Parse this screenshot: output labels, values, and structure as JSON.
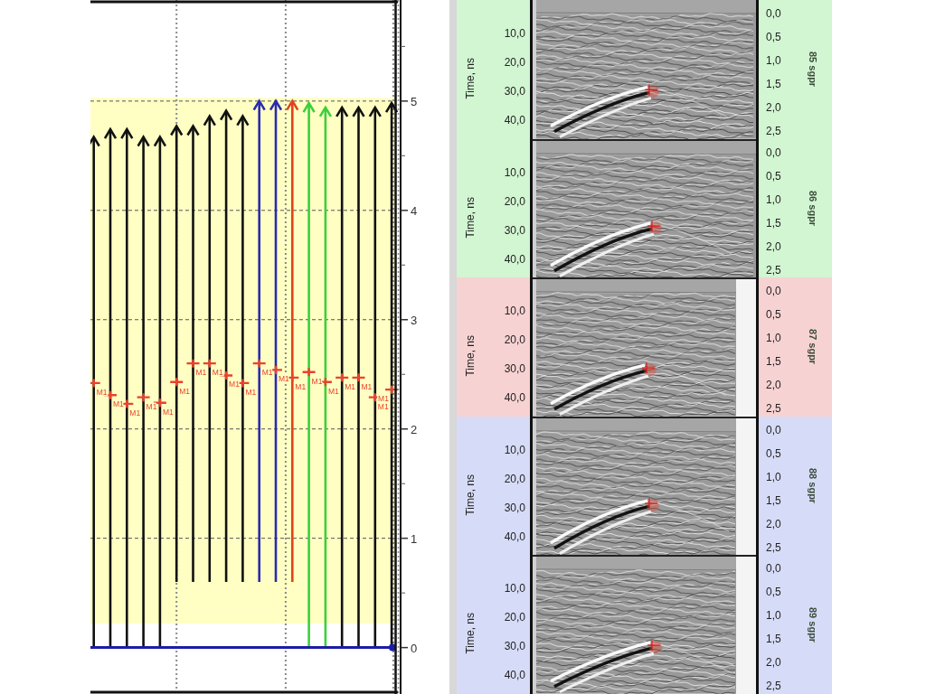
{
  "track_chart": {
    "arrows": [
      {
        "reaches_baseline": true
      },
      {
        "reaches_baseline": true
      },
      {
        "reaches_baseline": true
      },
      {
        "reaches_baseline": true
      },
      {
        "reaches_baseline": true
      },
      {
        "reaches_baseline": false
      },
      {
        "reaches_baseline": false
      },
      {
        "reaches_baseline": false
      },
      {
        "reaches_baseline": false
      },
      {
        "reaches_baseline": false
      },
      {
        "reaches_baseline": false
      },
      {
        "reaches_baseline": false
      },
      {
        "reaches_baseline": false
      },
      {
        "reaches_baseline": true
      },
      {
        "reaches_baseline": true
      },
      {
        "reaches_baseline": true
      },
      {
        "reaches_baseline": true
      },
      {
        "reaches_baseline": true
      },
      {
        "reaches_baseline": true
      }
    ],
    "chart_data": {
      "type": "scatter",
      "categories": [
        null,
        null,
        null,
        null,
        null,
        null,
        null,
        null,
        null,
        null,
        null,
        null,
        null,
        null,
        null,
        null,
        null,
        null,
        null
      ],
      "ylim": [
        -0.4,
        5.9
      ],
      "yticks": [
        {
          "value": 0,
          "label": "0"
        },
        {
          "value": 1,
          "label": "1"
        },
        {
          "value": 2,
          "label": "2"
        },
        {
          "value": 3,
          "label": "3"
        },
        {
          "value": 4,
          "label": "4"
        },
        {
          "value": 5,
          "label": "5"
        }
      ],
      "grid": true,
      "series": [
        {
          "color": "#e8432e",
          "values": [
            2.42,
            2.31,
            2.23,
            2.29,
            2.24,
            2.43,
            2.6,
            2.6,
            2.49,
            2.42,
            2.6,
            2.54,
            2.47,
            2.52,
            2.43,
            2.47,
            2.47,
            2.29,
            2.36
          ]
        },
        {
          "values": [
            4.63,
            4.7,
            4.7,
            4.63,
            4.63,
            4.73,
            4.73,
            4.82,
            4.87,
            4.82,
            4.96,
            4.96,
            4.96,
            4.94,
            4.9,
            4.9,
            4.9,
            4.9,
            4.94
          ],
          "colors": [
            "#111111",
            "#111111",
            "#111111",
            "#111111",
            "#111111",
            "#111111",
            "#111111",
            "#111111",
            "#111111",
            "#111111",
            "#2b2bb0",
            "#2b2bb0",
            "#e0441c",
            "#3ccf3c",
            "#3ccf3c",
            "#111111",
            "#111111",
            "#111111",
            "#111111"
          ]
        }
      ],
      "value_labels": [
        "M1",
        "M1",
        "M1",
        "M1",
        "M1",
        "M1",
        "M1",
        "M1",
        "M1",
        "M1",
        "M1",
        "M1",
        "M1",
        "M1",
        "M1",
        "M1",
        "M1",
        "M1",
        "M1"
      ],
      "bands": [
        {
          "axis": "y",
          "from": 0.22,
          "to": 5.03,
          "color": "#ffffc4"
        }
      ],
      "ref_lines": [
        {
          "axis": "y",
          "value": 0,
          "color": "#1c1ca8"
        }
      ]
    }
  },
  "radargrams": [
    {
      "color": "#d2f5d2",
      "trimmed": false,
      "time_title": "Time, ns",
      "time_ticks": [
        "10,0",
        "20,0",
        "30,0",
        "40,0"
      ],
      "depth_ticks": [
        "0,0",
        "0,5",
        "1,0",
        "1,5",
        "2,0",
        "2,5"
      ],
      "label": "85 sgpr"
    },
    {
      "color": "#d2f5d2",
      "trimmed": false,
      "time_title": "Time, ns",
      "time_ticks": [
        "10,0",
        "20,0",
        "30,0",
        "40,0"
      ],
      "depth_ticks": [
        "0,0",
        "0,5",
        "1,0",
        "1,5",
        "2,0",
        "2,5"
      ],
      "label": "86 sgpr"
    },
    {
      "color": "#f7d2d2",
      "trimmed": true,
      "time_title": "Time, ns",
      "time_ticks": [
        "10,0",
        "20,0",
        "30,0",
        "40,0"
      ],
      "depth_ticks": [
        "0,0",
        "0,5",
        "1,0",
        "1,5",
        "2,0",
        "2,5"
      ],
      "label": "87 sgpr"
    },
    {
      "color": "#d6dcf7",
      "trimmed": true,
      "time_title": "Time, ns",
      "time_ticks": [
        "10,0",
        "20,0",
        "30,0",
        "40,0"
      ],
      "depth_ticks": [
        "0,0",
        "0,5",
        "1,0",
        "1,5",
        "2,0",
        "2,5"
      ],
      "label": "88 sgpr"
    },
    {
      "color": "#d6dcf7",
      "trimmed": true,
      "time_title": "Time, ns",
      "time_ticks": [
        "10,0",
        "20,0",
        "30,0",
        "40,0"
      ],
      "depth_ticks": [
        "0,0",
        "0,5",
        "1,0",
        "1,5",
        "2,0",
        "2,5"
      ],
      "label": "89 sgpr"
    }
  ]
}
